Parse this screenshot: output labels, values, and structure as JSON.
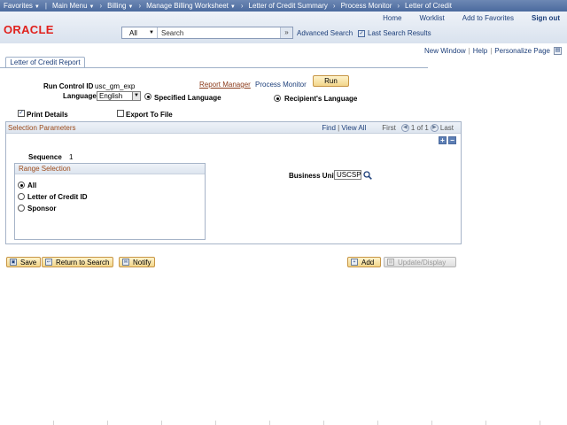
{
  "topnav": {
    "favorites": "Favorites",
    "main_menu": "Main Menu",
    "crumbs": [
      "Billing",
      "Manage Billing Worksheet",
      "Letter of Credit Summary",
      "Process Monitor",
      "Letter of Credit"
    ]
  },
  "header": {
    "logo": "ORACLE",
    "links": {
      "home": "Home",
      "worklist": "Worklist",
      "add_favorites": "Add to Favorites",
      "signout": "Sign out"
    },
    "search": {
      "scope": "All",
      "placeholder": "Search",
      "go": "»"
    },
    "advanced_search": "Advanced Search",
    "last_search": "Last Search Results"
  },
  "page_links": {
    "new_window": "New Window",
    "help": "Help",
    "personalize": "Personalize Page"
  },
  "tab": {
    "label": "Letter of Credit Report"
  },
  "form": {
    "run_control_label": "Run Control ID",
    "run_control_value": "usc_gm_exp",
    "report_manager": "Report Manager",
    "process_monitor": "Process Monitor",
    "run_label": "Run",
    "language_label": "Language",
    "language_value": "English",
    "specified_language": "Specified Language",
    "recipients_language": "Recipient's Language",
    "print_details": "Print Details",
    "export_to_file": "Export To File"
  },
  "selection": {
    "title": "Selection Parameters",
    "find": "Find",
    "view_all": "View All",
    "first": "First",
    "counter": "1 of 1",
    "last": "Last",
    "sequence_label": "Sequence",
    "sequence_value": "1",
    "range_title": "Range Selection",
    "options": [
      "All",
      "Letter of Credit ID",
      "Sponsor"
    ],
    "business_unit_label": "Business Unit",
    "business_unit_value": "USCSP"
  },
  "footer_buttons": {
    "save": "Save",
    "return_to_search": "Return to Search",
    "notify": "Notify",
    "add": "Add",
    "update_display": "Update/Display"
  }
}
